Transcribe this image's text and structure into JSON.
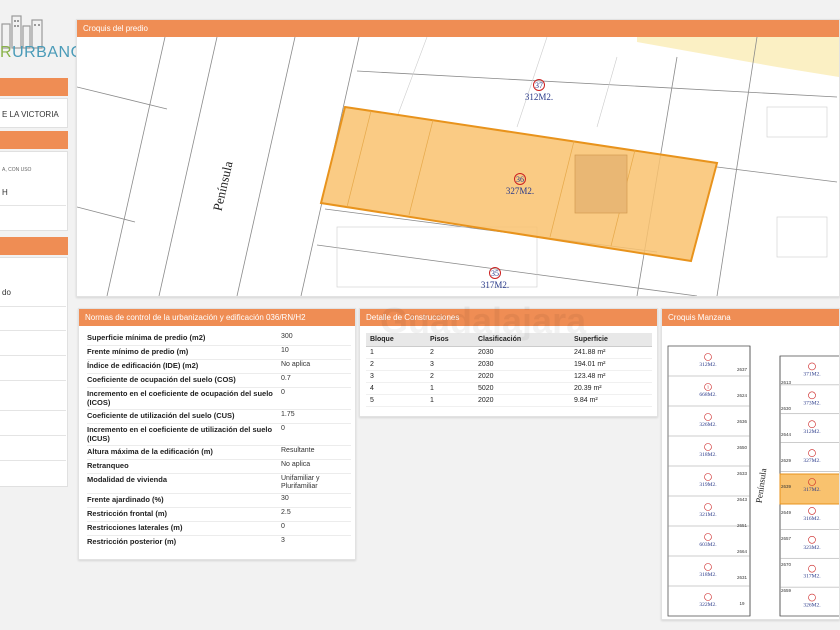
{
  "sidebar": {
    "logo_part1": "R",
    "logo_part2": "URBANO",
    "address_fragment": "E LA VICTORIA",
    "use_fragment": "A, CON USO",
    "code_fragment": "H",
    "item_fragment": "do"
  },
  "croquis_predio": {
    "title": "Croquis del predio",
    "street_label": "Península",
    "lots": [
      {
        "number": "37",
        "area": "312M2."
      },
      {
        "number": "36",
        "area": "327M2."
      },
      {
        "number": "35",
        "area": "317M2."
      }
    ],
    "highlight_color": "#f9c26e"
  },
  "normas": {
    "title": "Normas de control de la urbanización y edificación 036/RN/H2",
    "rows": [
      {
        "label": "Superficie mínima de predio (m2)",
        "value": "300"
      },
      {
        "label": "Frente mínimo de predio (m)",
        "value": "10"
      },
      {
        "label": "Índice de edificación (IDE) (m2)",
        "value": "No aplica"
      },
      {
        "label": "Coeficiente de ocupación del suelo (COS)",
        "value": "0.7"
      },
      {
        "label": "Incremento en el coeficiente de ocupación del suelo (ICOS)",
        "value": "0"
      },
      {
        "label": "Coeficiente de utilización del suelo (CUS)",
        "value": "1.75"
      },
      {
        "label": "Incremento en el coeficiente de utilización del suelo (ICUS)",
        "value": "0"
      },
      {
        "label": "Altura máxima de la edificación (m)",
        "value": "Resultante"
      },
      {
        "label": "Retranqueo",
        "value": "No aplica"
      },
      {
        "label": "Modalidad de vivienda",
        "value": "Unifamiliar y Plurifamiliar"
      },
      {
        "label": "Frente ajardinado (%)",
        "value": "30"
      },
      {
        "label": "Restricción frontal (m)",
        "value": "2.5"
      },
      {
        "label": "Restricciones laterales (m)",
        "value": "0"
      },
      {
        "label": "Restricción posterior (m)",
        "value": "3"
      }
    ]
  },
  "construcciones": {
    "title": "Detalle de Construcciones",
    "headers": [
      "Bloque",
      "Pisos",
      "Clasificación",
      "Superficie"
    ],
    "rows": [
      [
        "1",
        "2",
        "2030",
        "241.88 m²"
      ],
      [
        "2",
        "3",
        "2030",
        "194.01 m²"
      ],
      [
        "3",
        "2",
        "2020",
        "123.48 m²"
      ],
      [
        "4",
        "1",
        "5020",
        "20.39 m²"
      ],
      [
        "5",
        "1",
        "2020",
        "9.84 m²"
      ]
    ]
  },
  "croquis_manzana": {
    "title": "Croquis Manzana",
    "street_label": "Península",
    "lots_left": [
      {
        "number": "",
        "area": "312M2."
      },
      {
        "number": "1",
        "area": "668M2."
      },
      {
        "number": "",
        "area": "326M2."
      },
      {
        "number": "",
        "area": "318M2."
      },
      {
        "number": "",
        "area": "319M2."
      },
      {
        "number": "",
        "area": "321M2."
      },
      {
        "number": "",
        "area": "603M2."
      },
      {
        "number": "",
        "area": "318M2."
      },
      {
        "number": "",
        "area": "322M2."
      }
    ],
    "lots_right": [
      {
        "number": "",
        "area": "371M2."
      },
      {
        "number": "",
        "area": "373M2."
      },
      {
        "number": "",
        "area": "312M2."
      },
      {
        "number": "",
        "area": "327M2."
      },
      {
        "number": "",
        "area": "317M2."
      },
      {
        "number": "",
        "area": "316M2."
      },
      {
        "number": "",
        "area": "323M2."
      },
      {
        "number": "",
        "area": "317M2."
      },
      {
        "number": "",
        "area": "326M2."
      }
    ],
    "house_numbers": [
      "2637",
      "2613",
      "2624",
      "2630",
      "2636",
      "2644",
      "2650",
      "2629",
      "2633",
      "2639",
      "2643",
      "2649",
      "2651",
      "2657",
      "2664",
      "2670",
      "2631",
      "2659",
      "19"
    ]
  }
}
